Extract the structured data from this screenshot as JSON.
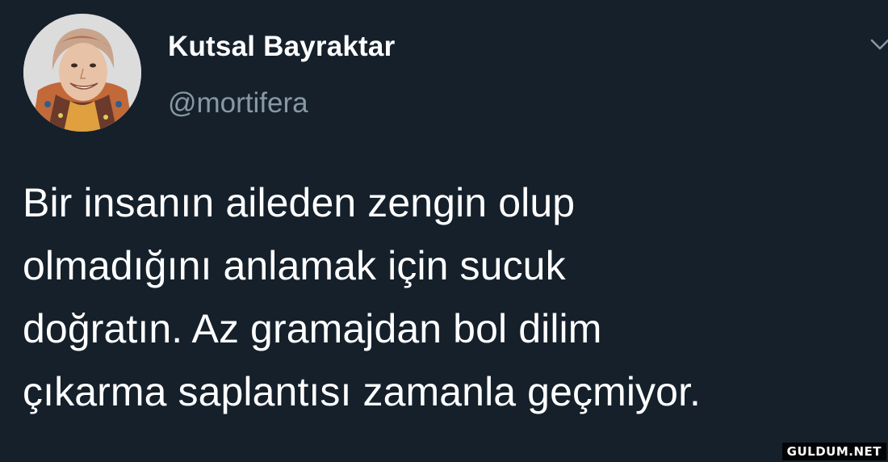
{
  "tweet": {
    "author": {
      "name": "Kutsal Bayraktar",
      "handle": "@mortifera"
    },
    "text": "Bir insanın aileden zengin olup\nolmadığını anlamak için sucuk\ndoğratın. Az gramajdan bol dilim\nçıkarma saplantısı zamanla geçmiyor."
  },
  "icons": {
    "avatar": "avatar",
    "menu": "chevron-down-icon"
  },
  "watermark": "GULDUM.NET",
  "colors": {
    "background": "#15202b",
    "text": "#ffffff",
    "handle": "#8899a6"
  }
}
